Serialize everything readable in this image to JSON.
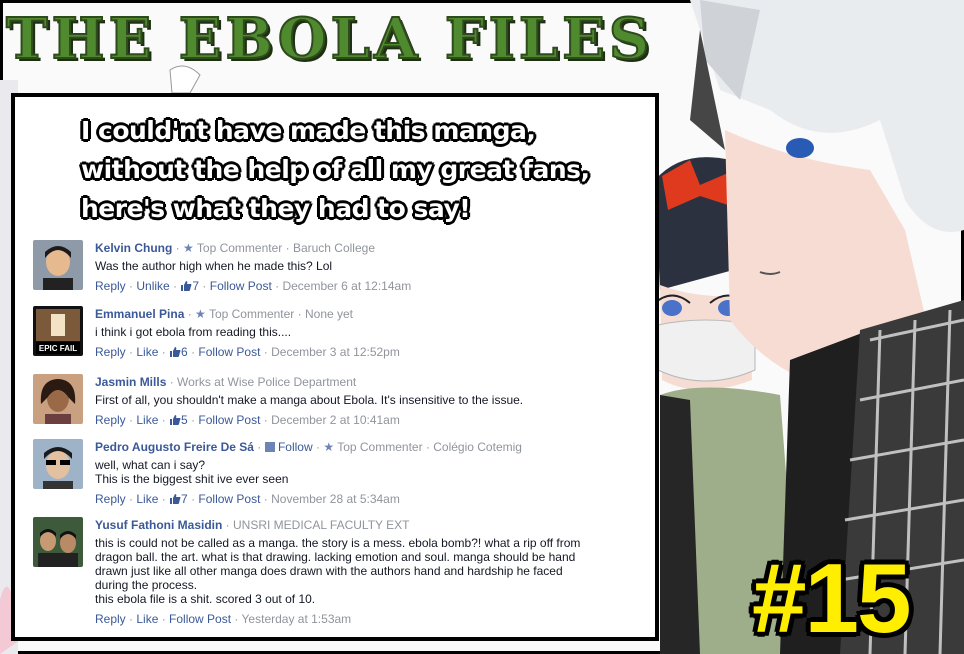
{
  "banner": {
    "title": "THE EBOLA FILES"
  },
  "headline": {
    "line1": "I could'nt have made this manga,",
    "line2": "without the help of all my great fans,",
    "line3": "here's what they had to say!"
  },
  "issue": {
    "number": "#15"
  },
  "comments": [
    {
      "name": "Kelvin Chung",
      "badge_sep": " · ",
      "badge": "Top Commenter",
      "detail": " · Baruch College",
      "text": "Was the author high when he made this? Lol",
      "reply": "Reply",
      "like": "Unlike",
      "likes": "7",
      "follow": "Follow Post",
      "time": "December 6 at 12:14am"
    },
    {
      "name": "Emmanuel Pina",
      "badge_sep": " · ",
      "badge": "Top Commenter",
      "detail": " · None yet",
      "text": "i think i got ebola from reading this....",
      "reply": "Reply",
      "like": "Like",
      "likes": "6",
      "follow": "Follow Post",
      "time": "December 3 at 12:52pm",
      "avatar_caption": "EPIC FAIL"
    },
    {
      "name": "Jasmin Mills",
      "detail": " · Works at Wise Police Department",
      "text": "First of all, you shouldn't make a manga about Ebola. It's insensitive to the issue.",
      "reply": "Reply",
      "like": "Like",
      "likes": "5",
      "follow": "Follow Post",
      "time": "December 2 at 10:41am"
    },
    {
      "name": "Pedro Augusto Freire De Sá",
      "follow_inline": "Follow",
      "badge_sep": " · ",
      "badge": "Top Commenter",
      "detail": " · Colégio Cotemig",
      "text": "well, what can i say?\nThis is the biggest shit ive ever seen",
      "reply": "Reply",
      "like": "Like",
      "likes": "7",
      "follow": "Follow Post",
      "time": "November 28 at 5:34am"
    },
    {
      "name": "Yusuf Fathoni Masidin",
      "detail": " · UNSRI MEDICAL FACULTY EXT",
      "text": "this is could not be called as a manga. the story is a mess. ebola bomb?! what a rip off from dragon ball. the art. what is that drawing. lacking emotion and soul. manga should be hand drawn just like all other manga does drawn with the authors hand and hardship he faced during the process.\nthis ebola file is a shit. scored 3 out of 10.",
      "reply": "Reply",
      "like": "Like",
      "follow": "Follow Post",
      "time": "Yesterday at 1:53am"
    }
  ],
  "colors": {
    "link": "#3b5998",
    "meta": "#90949c",
    "banner_green": "#4f8a2f",
    "issue_yellow": "#ffee00"
  }
}
